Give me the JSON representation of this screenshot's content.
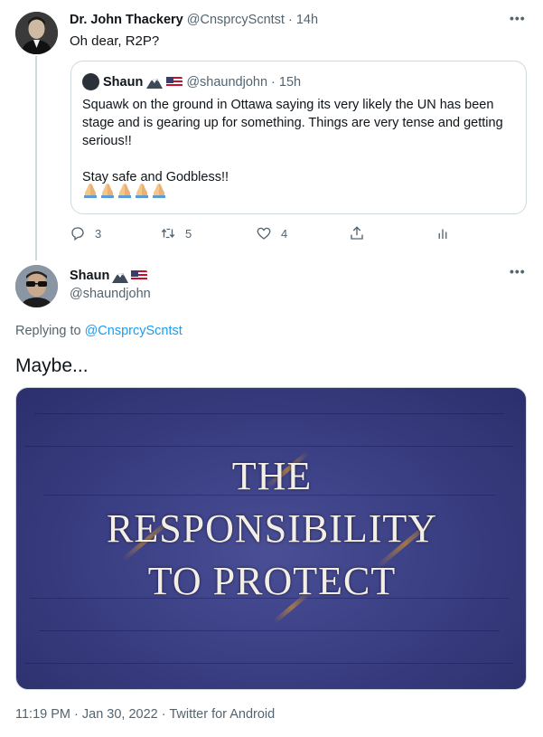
{
  "parent_tweet": {
    "author_name": "Dr. John Thackery",
    "author_handle": "@CnsprcyScntst",
    "time": "· 14h",
    "text": "Oh dear, R2P?",
    "more": "•••",
    "quote": {
      "author_name": "Shaun",
      "author_handle": "@shaundjohn",
      "time": "· 15h",
      "text": "Squawk on the ground in Ottawa saying its very likely the UN has been stage and is gearing up for something. Things are very tense and getting serious!!\n\nStay safe and Godbless!!",
      "emoji_count": 5
    },
    "actions": {
      "reply_count": "3",
      "retweet_count": "5",
      "like_count": "4"
    }
  },
  "reply_tweet": {
    "author_name": "Shaun",
    "author_handle": "@shaundjohn",
    "more": "•••",
    "replying_prefix": "Replying to",
    "replying_handle": "@CnsprcyScntst",
    "text": "Maybe...",
    "image": {
      "line1": "THE",
      "line2": "RESPONSIBILITY",
      "line3": "TO PROTECT"
    },
    "timestamp": "11:19 PM · Jan 30, 2022 · Twitter for Android"
  },
  "colors": {
    "link": "#1d9bf0",
    "muted": "#536471",
    "text": "#0f1419",
    "border": "#cfd9de"
  }
}
